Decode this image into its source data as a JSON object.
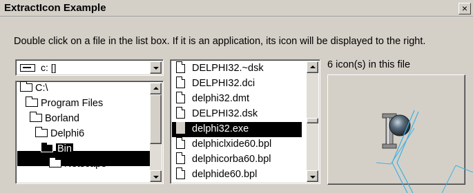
{
  "window": {
    "title": "ExtractIcon Example",
    "close_glyph": "×"
  },
  "instruction": "Double click on a file in the list box. If it is an application, its icon will be displayed to the right.",
  "drive": {
    "label": "c: []",
    "icon": "drive-icon"
  },
  "directories": [
    {
      "label": "C:\\",
      "icon": "open-folder-icon",
      "selected": false
    },
    {
      "label": "Program Files",
      "icon": "open-folder-icon",
      "selected": false
    },
    {
      "label": "Borland",
      "icon": "open-folder-icon",
      "selected": false
    },
    {
      "label": "Delphi6",
      "icon": "open-folder-icon",
      "selected": false
    },
    {
      "label": "Bin",
      "icon": "open-folder-icon",
      "selected": true
    },
    {
      "label": "Netscap3",
      "icon": "folder-icon",
      "selected": false
    }
  ],
  "files": [
    {
      "name": "DELPHI32.~dsk",
      "selected": false
    },
    {
      "name": "DELPHI32.dci",
      "selected": false
    },
    {
      "name": "delphi32.dmt",
      "selected": false
    },
    {
      "name": "DELPHI32.dsk",
      "selected": false
    },
    {
      "name": "delphi32.exe",
      "selected": true
    },
    {
      "name": "delphiclxide60.bpl",
      "selected": false
    },
    {
      "name": "delphicorba60.bpl",
      "selected": false
    },
    {
      "name": "delphide60.bpl",
      "selected": false
    }
  ],
  "icon_count_text": "6 icon(s) in this file",
  "extracted_icon": "delphi-helmet-icon",
  "colors": {
    "face": "#d4d0c8",
    "selection": "#000000",
    "icon_ball": "#4a5a6a"
  }
}
